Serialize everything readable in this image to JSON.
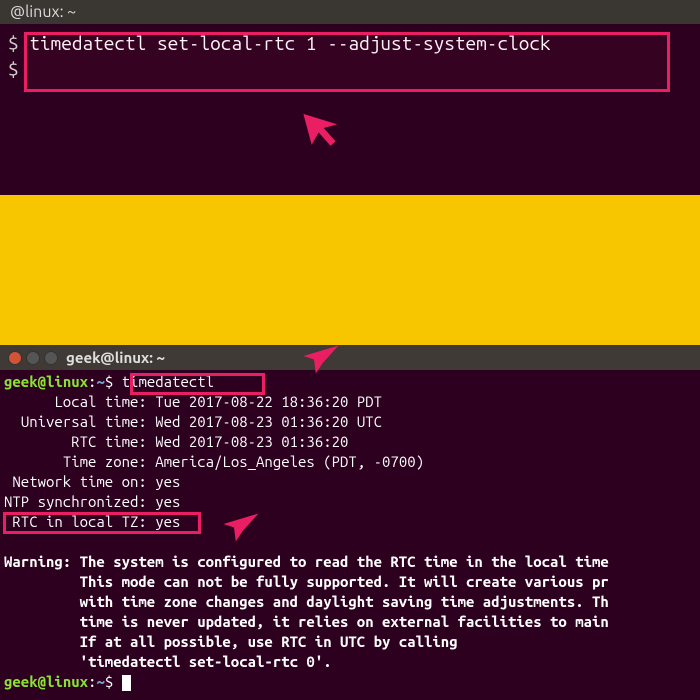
{
  "top_terminal": {
    "title": "@linux: ~",
    "prompt": "$",
    "command": "timedatectl set-local-rtc 1 --adjust-system-clock"
  },
  "bottom_terminal": {
    "title": "geek@linux: ~",
    "user": "geek",
    "host": "linux",
    "path": "~",
    "prompt_sep": ":",
    "prompt_end": "$",
    "command": "timedatectl",
    "output": {
      "local_time_label": "Local time:",
      "local_time_value": "Tue 2017-08-22 18:36:20 PDT",
      "universal_time_label": "Universal time:",
      "universal_time_value": "Wed 2017-08-23 01:36:20 UTC",
      "rtc_time_label": "RTC time:",
      "rtc_time_value": "Wed 2017-08-23 01:36:20",
      "timezone_label": "Time zone:",
      "timezone_value": "America/Los_Angeles (PDT, -0700)",
      "network_label": "Network time on:",
      "network_value": "yes",
      "ntp_label": "NTP synchronized:",
      "ntp_value": "yes",
      "rtc_local_label": "RTC in local TZ:",
      "rtc_local_value": "yes"
    },
    "warning": {
      "prefix": "Warning:",
      "l1": "The system is configured to read the RTC time in the local time",
      "l2": "This mode can not be fully supported. It will create various pr",
      "l3": "with time zone changes and daylight saving time adjustments. Th",
      "l4": "time is never updated, it relies on external facilities to main",
      "l5": "If at all possible, use RTC in UTC by calling",
      "l6": "'timedatectl set-local-rtc 0'."
    }
  }
}
